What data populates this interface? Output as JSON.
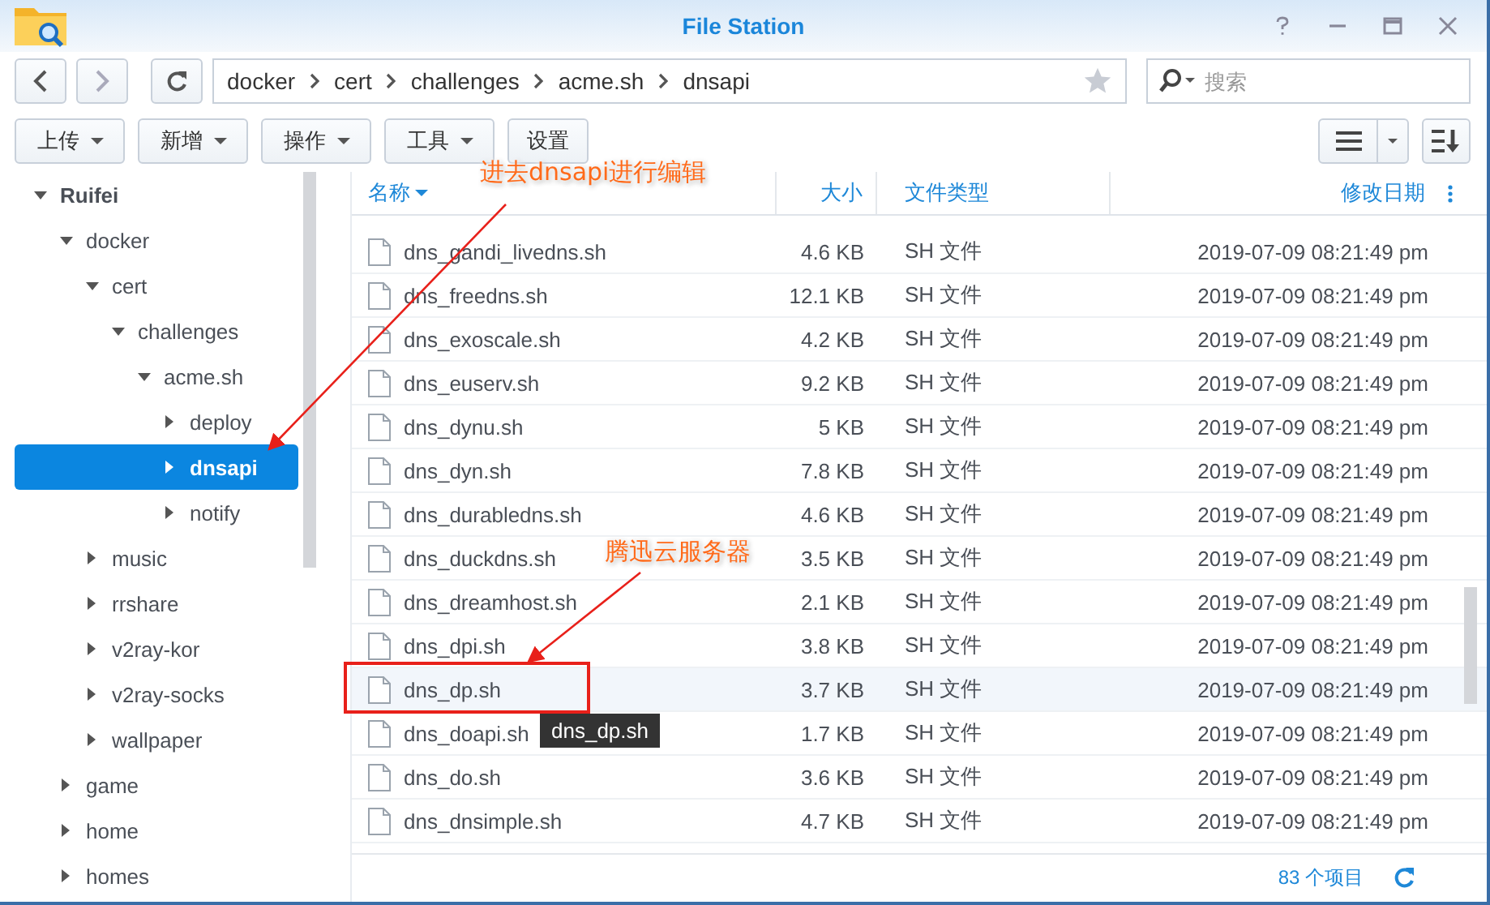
{
  "window": {
    "title": "File Station"
  },
  "nav": {
    "path": [
      "docker",
      "cert",
      "challenges",
      "acme.sh",
      "dnsapi"
    ],
    "search": {
      "placeholder": "搜索"
    }
  },
  "toolbar": {
    "buttons": [
      {
        "label": "上传",
        "kind": "menu"
      },
      {
        "label": "新增",
        "kind": "menu"
      },
      {
        "label": "操作",
        "kind": "menu"
      },
      {
        "label": "工具",
        "kind": "menu"
      },
      {
        "label": "设置",
        "kind": "plain"
      }
    ]
  },
  "tree": [
    {
      "label": "Ruifei",
      "expanded": true,
      "selected": false,
      "children": [
        {
          "label": "docker",
          "expanded": true,
          "selected": false,
          "children": [
            {
              "label": "cert",
              "expanded": true,
              "selected": false,
              "children": [
                {
                  "label": "challenges",
                  "expanded": true,
                  "selected": false,
                  "children": [
                    {
                      "label": "acme.sh",
                      "expanded": true,
                      "selected": false,
                      "children": [
                        {
                          "label": "deploy",
                          "expanded": false,
                          "selected": false
                        },
                        {
                          "label": "dnsapi",
                          "expanded": false,
                          "selected": true
                        },
                        {
                          "label": "notify",
                          "expanded": false,
                          "selected": false
                        }
                      ]
                    }
                  ]
                }
              ]
            },
            {
              "label": "music",
              "expanded": false,
              "selected": false
            },
            {
              "label": "rrshare",
              "expanded": false,
              "selected": false
            },
            {
              "label": "v2ray-kor",
              "expanded": false,
              "selected": false
            },
            {
              "label": "v2ray-socks",
              "expanded": false,
              "selected": false
            },
            {
              "label": "wallpaper",
              "expanded": false,
              "selected": false
            }
          ]
        },
        {
          "label": "game",
          "expanded": false,
          "selected": false
        },
        {
          "label": "home",
          "expanded": false,
          "selected": false
        },
        {
          "label": "homes",
          "expanded": false,
          "selected": false
        }
      ]
    }
  ],
  "table": {
    "columns": [
      "名称",
      "大小",
      "文件类型",
      "修改日期"
    ],
    "rows": [
      {
        "name": "dns_gandi_livedns.sh",
        "size": "4.6 KB",
        "type": "SH 文件",
        "date": "2019-07-09 08:21:49 pm",
        "hovered": false
      },
      {
        "name": "dns_freedns.sh",
        "size": "12.1 KB",
        "type": "SH 文件",
        "date": "2019-07-09 08:21:49 pm",
        "hovered": false
      },
      {
        "name": "dns_exoscale.sh",
        "size": "4.2 KB",
        "type": "SH 文件",
        "date": "2019-07-09 08:21:49 pm",
        "hovered": false
      },
      {
        "name": "dns_euserv.sh",
        "size": "9.2 KB",
        "type": "SH 文件",
        "date": "2019-07-09 08:21:49 pm",
        "hovered": false
      },
      {
        "name": "dns_dynu.sh",
        "size": "5 KB",
        "type": "SH 文件",
        "date": "2019-07-09 08:21:49 pm",
        "hovered": false
      },
      {
        "name": "dns_dyn.sh",
        "size": "7.8 KB",
        "type": "SH 文件",
        "date": "2019-07-09 08:21:49 pm",
        "hovered": false
      },
      {
        "name": "dns_durabledns.sh",
        "size": "4.6 KB",
        "type": "SH 文件",
        "date": "2019-07-09 08:21:49 pm",
        "hovered": false
      },
      {
        "name": "dns_duckdns.sh",
        "size": "3.5 KB",
        "type": "SH 文件",
        "date": "2019-07-09 08:21:49 pm",
        "hovered": false
      },
      {
        "name": "dns_dreamhost.sh",
        "size": "2.1 KB",
        "type": "SH 文件",
        "date": "2019-07-09 08:21:49 pm",
        "hovered": false
      },
      {
        "name": "dns_dpi.sh",
        "size": "3.8 KB",
        "type": "SH 文件",
        "date": "2019-07-09 08:21:49 pm",
        "hovered": false
      },
      {
        "name": "dns_dp.sh",
        "size": "3.7 KB",
        "type": "SH 文件",
        "date": "2019-07-09 08:21:49 pm",
        "hovered": true
      },
      {
        "name": "dns_doapi.sh",
        "size": "1.7 KB",
        "type": "SH 文件",
        "date": "2019-07-09 08:21:49 pm",
        "hovered": false
      },
      {
        "name": "dns_do.sh",
        "size": "3.6 KB",
        "type": "SH 文件",
        "date": "2019-07-09 08:21:49 pm",
        "hovered": false
      },
      {
        "name": "dns_dnsimple.sh",
        "size": "4.7 KB",
        "type": "SH 文件",
        "date": "2019-07-09 08:21:49 pm",
        "hovered": false
      }
    ]
  },
  "tooltip": {
    "text": "dns_dp.sh"
  },
  "status_bar": {
    "count": "83 个项目"
  },
  "annotations": [
    {
      "text": "进去dnsapi进行编辑"
    },
    {
      "text": "腾迅云服务器"
    }
  ]
}
